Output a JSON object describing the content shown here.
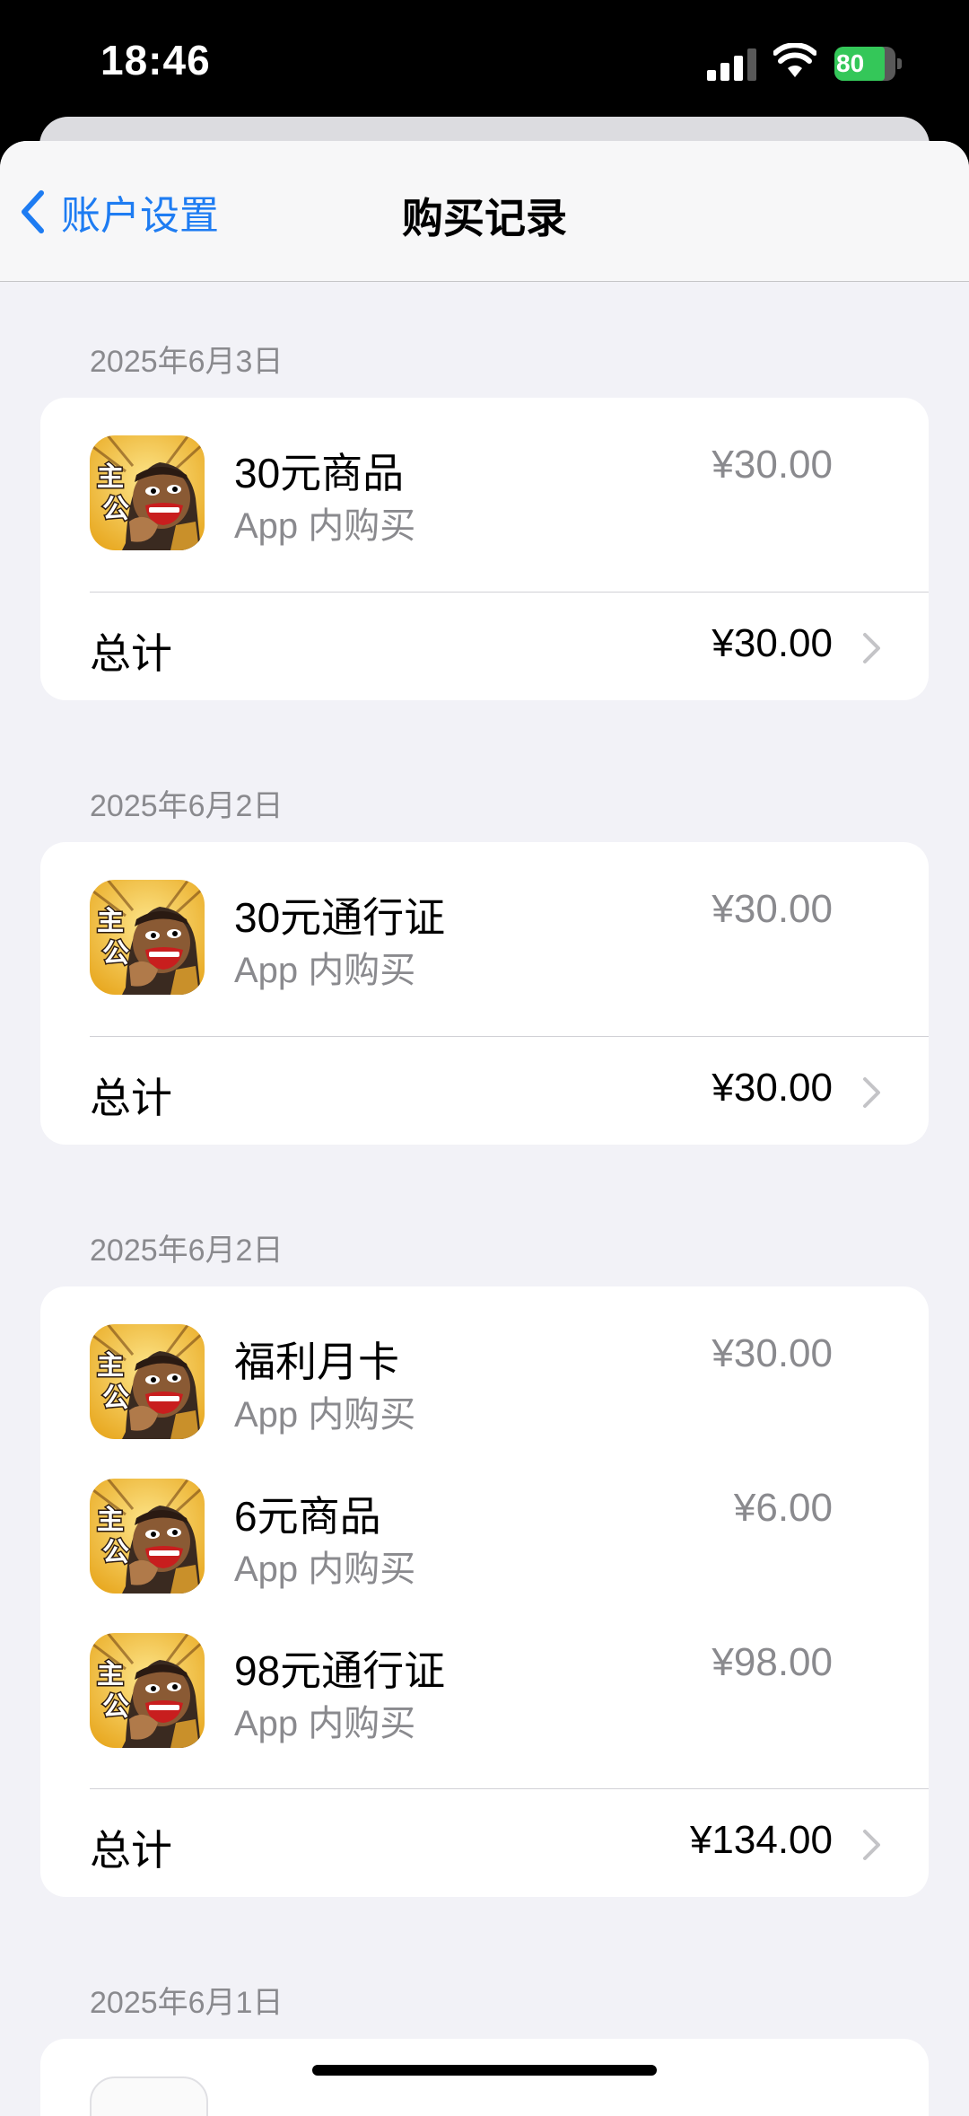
{
  "status_bar": {
    "time": "18:46",
    "battery": "80"
  },
  "nav": {
    "back_label": "账户设置",
    "title": "购买记录"
  },
  "groups": [
    {
      "date": "2025年6月3日",
      "items": [
        {
          "name": "30元商品",
          "subtitle": "App 内购买",
          "price": "¥30.00"
        }
      ],
      "total_label": "总计",
      "total": "¥30.00"
    },
    {
      "date": "2025年6月2日",
      "items": [
        {
          "name": "30元通行证",
          "subtitle": "App 内购买",
          "price": "¥30.00"
        }
      ],
      "total_label": "总计",
      "total": "¥30.00"
    },
    {
      "date": "2025年6月2日",
      "items": [
        {
          "name": "福利月卡",
          "subtitle": "App 内购买",
          "price": "¥30.00"
        },
        {
          "name": "6元商品",
          "subtitle": "App 内购买",
          "price": "¥6.00"
        },
        {
          "name": "98元通行证",
          "subtitle": "App 内购买",
          "price": "¥98.00"
        }
      ],
      "total_label": "总计",
      "total": "¥134.00"
    },
    {
      "date": "2025年6月1日"
    }
  ]
}
